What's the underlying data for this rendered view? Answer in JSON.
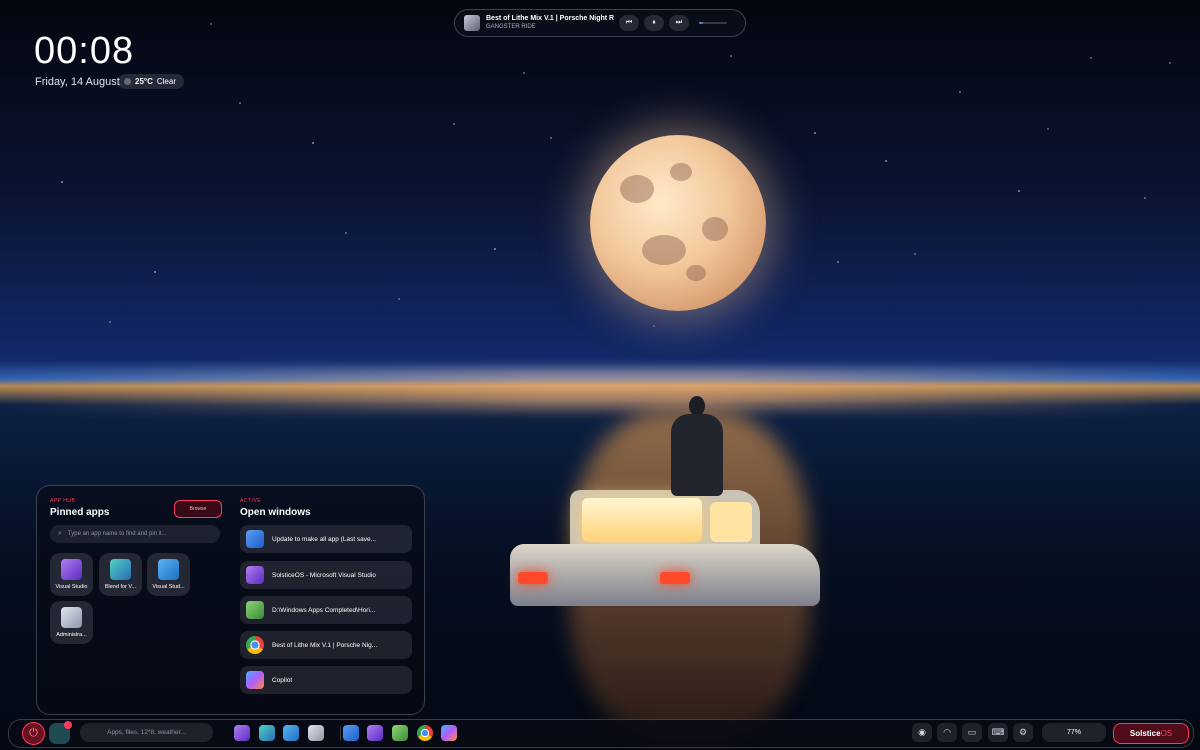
{
  "clock": {
    "time": "00:08",
    "date": "Friday, 14 August"
  },
  "weather": {
    "temp": "25°C",
    "condition": "Clear"
  },
  "media": {
    "title": "Best of Lithe Mix V.1 | Porsche Night R...",
    "artist": "GANGSTER RIDE",
    "prev_icon": "previous-icon",
    "pause_icon": "pause-icon",
    "next_icon": "next-icon",
    "progress": 0.15
  },
  "pinned": {
    "subheading": "APP HUB",
    "heading": "Pinned apps",
    "browse_label": "Browse",
    "search_placeholder": "Type an app name to find and pin it...",
    "apps": [
      {
        "label": "Visual Studio",
        "icon": "visual-studio-icon"
      },
      {
        "label": "Blend for V...",
        "icon": "blend-icon"
      },
      {
        "label": "Visual Stud...",
        "icon": "vscode-icon"
      },
      {
        "label": "Administra...",
        "icon": "admin-tools-icon"
      }
    ]
  },
  "open_windows": {
    "subheading": "ACTIVE",
    "heading": "Open windows",
    "items": [
      {
        "label": "Update to make all app (Last save...",
        "icon": "word-icon"
      },
      {
        "label": "SolsticeOS - Microsoft Visual Studio",
        "icon": "visual-studio-icon"
      },
      {
        "label": "D:\\Windows Apps Completed\\Hori...",
        "icon": "notepad-icon"
      },
      {
        "label": "Best of Lithe Mix V.1 | Porsche Nig...",
        "icon": "chrome-icon"
      },
      {
        "label": "Copilot",
        "icon": "copilot-icon"
      }
    ]
  },
  "taskbar": {
    "search_placeholder": "Apps, files, 12*8, weather...",
    "battery": "77%",
    "brand_main": "Solstice",
    "brand_suffix": "OS"
  },
  "colors": {
    "accent": "#ff3b5c",
    "panel_bg": "#080a14",
    "sky_top": "#04060f",
    "sky_horizon": "#2f62b3"
  }
}
